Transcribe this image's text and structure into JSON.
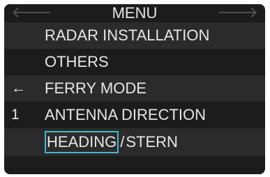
{
  "menu": {
    "title": "MENU",
    "back_arrow": "🡐",
    "forward_arrow": "🡒",
    "items": [
      {
        "marker": "",
        "label": "RADAR INSTALLATION"
      },
      {
        "marker": "",
        "label": "OTHERS"
      },
      {
        "marker": "←",
        "label": "FERRY MODE"
      },
      {
        "marker": "1",
        "label": "ANTENNA DIRECTION"
      }
    ],
    "options": {
      "selected": "HEADING",
      "separator": "/",
      "other": "STERN"
    }
  },
  "colors": {
    "background": "#1c1c1c",
    "band": "#2b2b2b",
    "text": "#e6e6e6",
    "selection_border": "#46b8d0",
    "inactive_arrow": "#555555"
  }
}
